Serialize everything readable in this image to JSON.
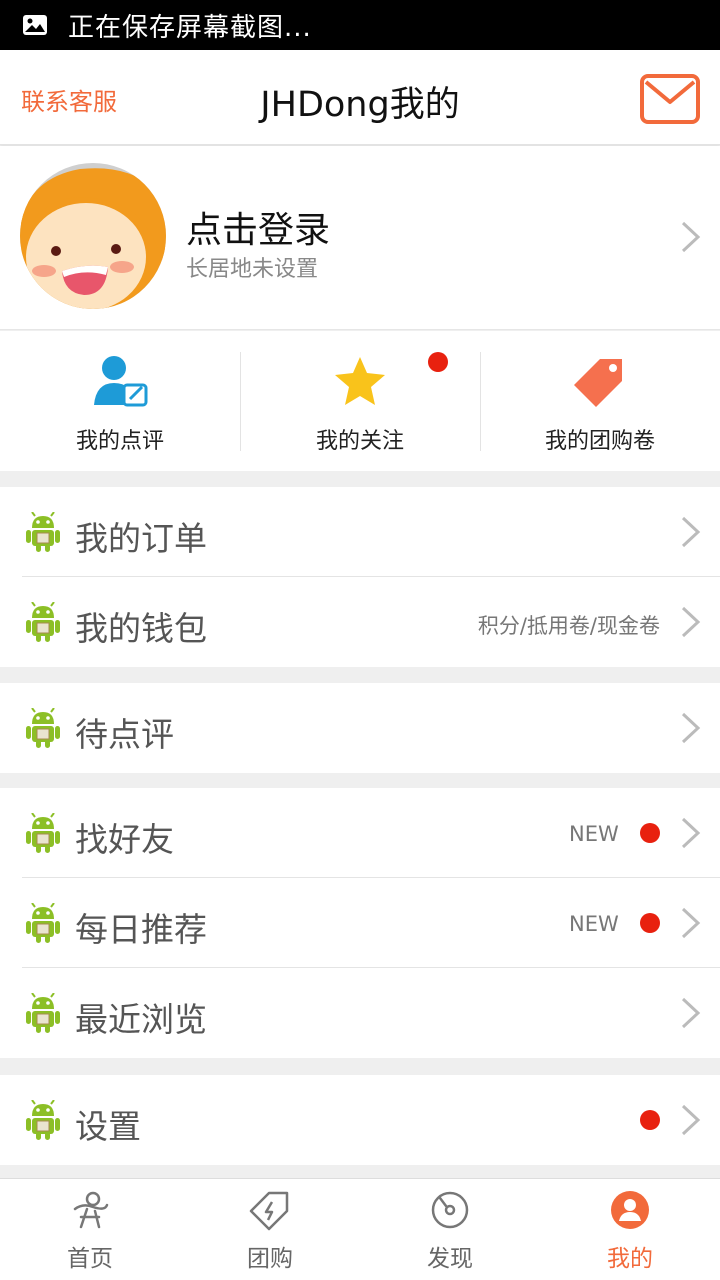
{
  "status_bar": {
    "text": "正在保存屏幕截图..."
  },
  "header": {
    "contact": "联系客服",
    "title": "JHDong我的",
    "mail_icon": "mail-icon"
  },
  "profile": {
    "login": "点击登录",
    "location": "长居地未设置"
  },
  "quick_actions": [
    {
      "label": "我的点评",
      "icon": "user-review-icon",
      "badge": false
    },
    {
      "label": "我的关注",
      "icon": "star-icon",
      "badge": true
    },
    {
      "label": "我的团购卷",
      "icon": "tag-icon",
      "badge": false
    }
  ],
  "menu": [
    {
      "label": "我的订单",
      "extra": "",
      "new": "",
      "dot": false
    },
    {
      "label": "我的钱包",
      "extra": "积分/抵用卷/现金卷",
      "new": "",
      "dot": false
    },
    {
      "label": "待点评",
      "extra": "",
      "new": "",
      "dot": false
    },
    {
      "label": "找好友",
      "extra": "",
      "new": "NEW",
      "dot": true
    },
    {
      "label": "每日推荐",
      "extra": "",
      "new": "NEW",
      "dot": true
    },
    {
      "label": "最近浏览",
      "extra": "",
      "new": "",
      "dot": false
    },
    {
      "label": "设置",
      "extra": "",
      "new": "",
      "dot": true
    }
  ],
  "tabs": [
    {
      "label": "首页",
      "icon": "home-figure-icon",
      "active": false
    },
    {
      "label": "团购",
      "icon": "deal-tag-icon",
      "active": false
    },
    {
      "label": "发现",
      "icon": "compass-icon",
      "active": false
    },
    {
      "label": "我的",
      "icon": "profile-icon",
      "active": true
    }
  ],
  "colors": {
    "accent": "#f26a3b",
    "badge": "#e8210f",
    "android": "#8cbf26"
  }
}
